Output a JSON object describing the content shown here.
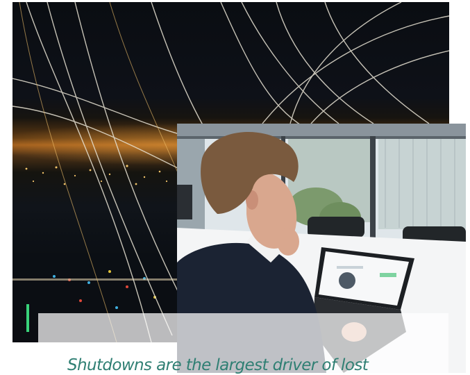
{
  "images": {
    "background": "night-airport-light-trails",
    "foreground": "man-working-on-laptop-in-office"
  },
  "caption": {
    "text": "Shutdowns are the largest driver of lost"
  },
  "colors": {
    "caption_text": "#2f7f73",
    "panel_overlay": "#ffffff"
  }
}
